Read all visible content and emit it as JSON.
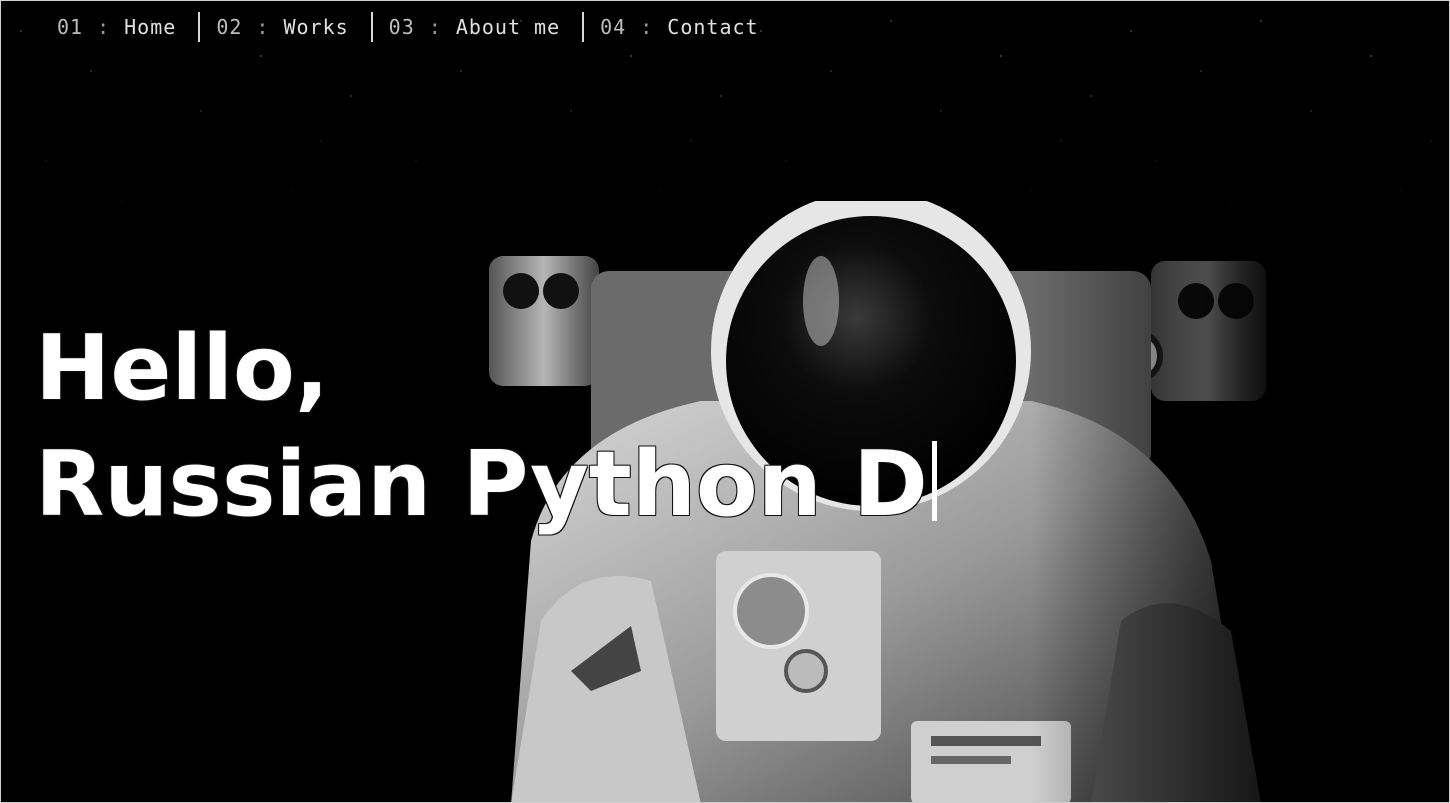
{
  "nav": {
    "items": [
      {
        "num": "01",
        "sep": ":",
        "label": "Home"
      },
      {
        "num": "02",
        "sep": ":",
        "label": "Works"
      },
      {
        "num": "03",
        "sep": ":",
        "label": "About me"
      },
      {
        "num": "04",
        "sep": ":",
        "label": "Contact"
      }
    ]
  },
  "hero": {
    "line1": "Hello,",
    "line2": "Russian Python D"
  },
  "colors": {
    "background": "#000000",
    "text": "#ffffff",
    "nav_text": "#d8d8d8"
  },
  "icons": {
    "caret": "text-cursor-icon",
    "background_image": "astronaut-image"
  }
}
